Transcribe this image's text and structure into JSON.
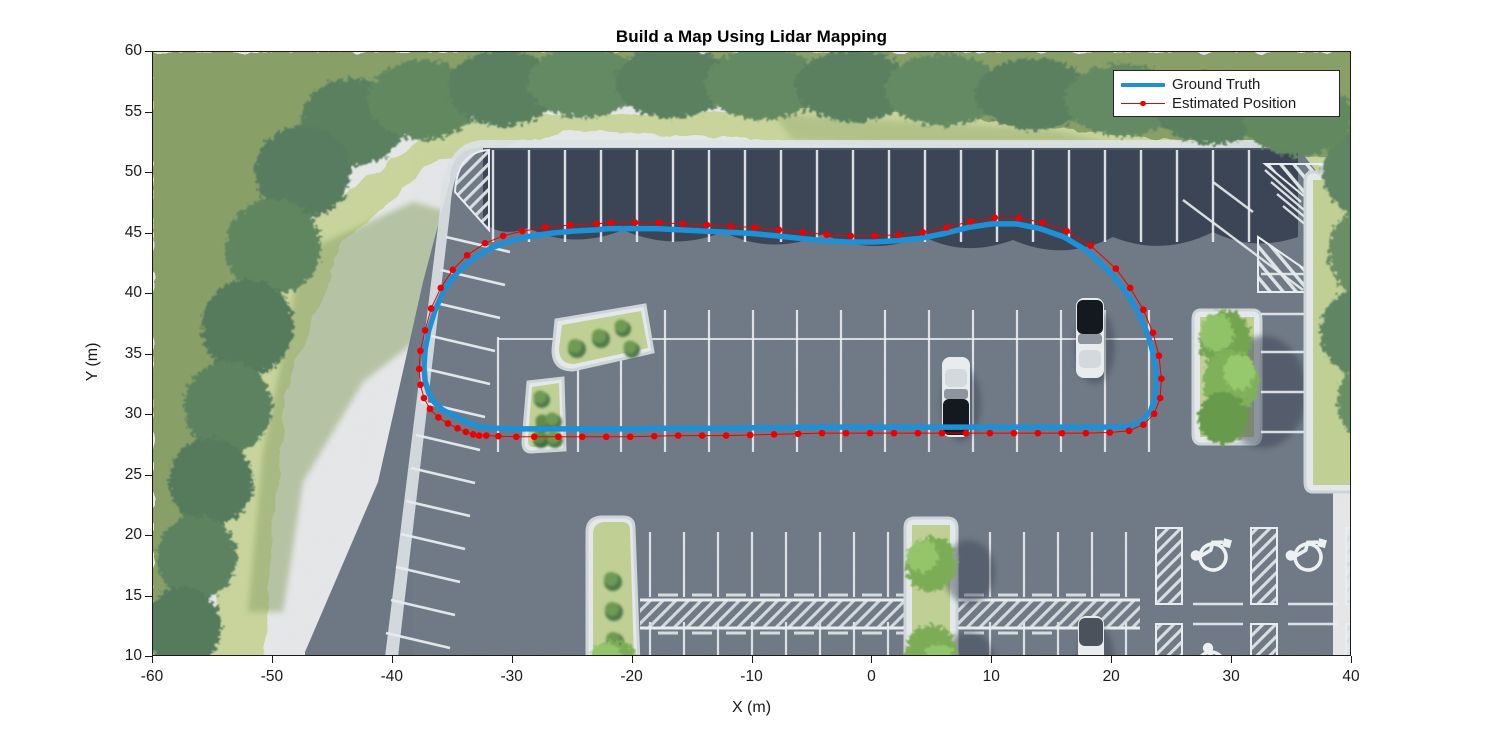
{
  "figure": {
    "title": "Build a Map Using Lidar Mapping",
    "background_color": "#ffffff"
  },
  "axes": {
    "xlabel": "X (m)",
    "ylabel": "Y (m)",
    "xlim": [
      -60,
      40
    ],
    "ylim": [
      10,
      60
    ],
    "xticks": [
      -60,
      -50,
      -40,
      -30,
      -20,
      -10,
      0,
      10,
      20,
      30,
      40
    ],
    "xticklabels": [
      "-60",
      "-50",
      "-40",
      "-30",
      "-20",
      "-10",
      "0",
      "10",
      "20",
      "30",
      "40"
    ],
    "yticks": [
      10,
      15,
      20,
      25,
      30,
      35,
      40,
      45,
      50,
      55,
      60
    ],
    "yticklabels": [
      "10",
      "15",
      "20",
      "25",
      "30",
      "35",
      "40",
      "45",
      "50",
      "55",
      "60"
    ],
    "grid": false,
    "box": true,
    "axis_color": "#1a1a1a"
  },
  "legend": {
    "location": "northeast",
    "entries": [
      {
        "label": "Ground Truth",
        "color": "#1f8fd6",
        "style": "thick-line",
        "icon": "line-sample-icon"
      },
      {
        "label": "Estimated Position",
        "color": "#ee0000",
        "style": "thin-line-with-marker",
        "icon": "line-marker-sample-icon"
      }
    ]
  },
  "chart_data": {
    "type": "line",
    "title": "Build a Map Using Lidar Mapping",
    "xlabel": "X (m)",
    "ylabel": "Y (m)",
    "xlim": [
      -60,
      40
    ],
    "ylim": [
      10,
      60
    ],
    "grid": false,
    "legend_position": "upper right",
    "background_image": "aerial-parking-lot-orthophoto",
    "series": [
      {
        "name": "Ground Truth",
        "color": "#1f8fd6",
        "linewidth": 4,
        "marker": "none",
        "x": [
          -23.0,
          -25.0,
          -27.0,
          -29.0,
          -30.5,
          -32.0,
          -33.5,
          -34.8,
          -35.8,
          -36.5,
          -37.0,
          -37.3,
          -37.4,
          -37.3,
          -37.0,
          -36.5,
          -35.8,
          -35.0,
          -34.2,
          -33.5,
          -33.0,
          -32.5,
          -32.0,
          -31.0,
          -29.5,
          -28.0,
          -26.0,
          -24.0,
          -22.0,
          -20.0,
          -18.0,
          -16.0,
          -14.0,
          -12.0,
          -10.0,
          -8.0,
          -6.0,
          -4.0,
          -2.0,
          0.0,
          2.0,
          4.0,
          6.0,
          8.0,
          10.0,
          12.0,
          14.0,
          16.0,
          18.0,
          20.0,
          21.5,
          22.5,
          23.2,
          23.6,
          23.7,
          23.5,
          23.0,
          22.2,
          21.2,
          20.0,
          18.0,
          16.0,
          14.0,
          12.0,
          10.0,
          8.0,
          6.0,
          4.0,
          2.0,
          0.0,
          -2.0,
          -4.0,
          -6.0,
          -8.0,
          -10.0,
          -12.0,
          -14.0,
          -16.0,
          -18.0,
          -20.0,
          -22.0,
          -23.0
        ],
        "y": [
          45.3,
          45.2,
          45.0,
          44.7,
          44.3,
          43.7,
          42.8,
          41.6,
          40.2,
          38.6,
          37.0,
          35.4,
          34.0,
          32.8,
          31.8,
          31.0,
          30.4,
          30.0,
          29.6,
          29.3,
          29.1,
          29.0,
          28.95,
          28.9,
          28.85,
          28.85,
          28.85,
          28.85,
          28.85,
          28.85,
          28.9,
          28.9,
          28.9,
          28.9,
          28.95,
          28.95,
          29.0,
          29.0,
          29.0,
          29.0,
          29.0,
          29.0,
          29.0,
          29.0,
          29.0,
          29.0,
          29.0,
          29.0,
          29.0,
          29.0,
          29.1,
          29.5,
          30.3,
          31.5,
          33.0,
          34.8,
          36.6,
          38.4,
          40.1,
          41.6,
          43.5,
          44.7,
          45.4,
          45.8,
          45.8,
          45.5,
          45.0,
          44.6,
          44.4,
          44.3,
          44.3,
          44.4,
          44.6,
          44.8,
          45.0,
          45.1,
          45.2,
          45.3,
          45.4,
          45.4,
          45.4,
          45.3
        ]
      },
      {
        "name": "Estimated Position",
        "color": "#ee0000",
        "linewidth": 1,
        "marker": "o",
        "markersize": 6,
        "offset_note": "offset slightly outward from ground truth",
        "x": [
          -23.0,
          -25.2,
          -27.3,
          -29.2,
          -30.8,
          -32.3,
          -33.8,
          -35.0,
          -36.0,
          -36.8,
          -37.3,
          -37.7,
          -37.8,
          -37.7,
          -37.4,
          -36.9,
          -36.2,
          -35.4,
          -34.6,
          -33.9,
          -33.3,
          -32.8,
          -32.2,
          -31.2,
          -29.7,
          -28.2,
          -26.2,
          -24.2,
          -22.2,
          -20.2,
          -18.2,
          -16.2,
          -14.2,
          -12.2,
          -10.2,
          -8.2,
          -6.2,
          -4.2,
          -2.2,
          -0.2,
          1.8,
          3.8,
          5.8,
          7.8,
          9.8,
          11.8,
          13.8,
          15.8,
          17.8,
          19.8,
          21.4,
          22.6,
          23.5,
          24.0,
          24.1,
          23.9,
          23.4,
          22.6,
          21.5,
          20.3,
          18.2,
          16.2,
          14.2,
          12.2,
          10.2,
          8.2,
          6.2,
          4.2,
          2.2,
          0.2,
          -1.8,
          -3.8,
          -5.8,
          -7.8,
          -9.8,
          -11.8,
          -13.8,
          -15.8,
          -17.8,
          -19.8,
          -21.8,
          -23.0
        ],
        "y": [
          45.8,
          45.7,
          45.5,
          45.2,
          44.8,
          44.2,
          43.2,
          42.0,
          40.5,
          38.8,
          37.0,
          35.3,
          33.8,
          32.5,
          31.4,
          30.5,
          29.8,
          29.3,
          28.9,
          28.6,
          28.4,
          28.3,
          28.3,
          28.25,
          28.2,
          28.2,
          28.2,
          28.2,
          28.2,
          28.2,
          28.25,
          28.3,
          28.3,
          28.3,
          28.35,
          28.4,
          28.45,
          28.5,
          28.5,
          28.5,
          28.5,
          28.5,
          28.5,
          28.5,
          28.5,
          28.5,
          28.5,
          28.5,
          28.5,
          28.55,
          28.7,
          29.2,
          30.1,
          31.4,
          33.0,
          34.9,
          36.8,
          38.7,
          40.5,
          42.1,
          44.0,
          45.2,
          45.9,
          46.3,
          46.3,
          46.0,
          45.5,
          45.1,
          44.9,
          44.8,
          44.8,
          44.9,
          45.1,
          45.3,
          45.5,
          45.6,
          45.7,
          45.8,
          45.9,
          45.9,
          45.9,
          45.8
        ]
      }
    ]
  },
  "scene": {
    "description": "aerial orthophoto of a parking lot",
    "regions": {
      "sky_gray": "#e5e6e7",
      "grass_dark": "#7c9460",
      "grass_light": "#c3cf94",
      "asphalt": "#6e7884",
      "asphalt_shadow": "#353f52",
      "stripe": "#e9edf0",
      "island_grass": "#bcd092",
      "tree_dark": "#4e7050",
      "tree_light": "#8fbc58",
      "car_white": "#e8ecee",
      "car_dark": "#1b1f26"
    },
    "markings": {
      "accessible_symbol": "wheelchair-icon",
      "accessible_count": 3,
      "hatched_zones": "diagonal-hatch-aisles",
      "crosswalk": "ladder-crosswalk"
    }
  }
}
